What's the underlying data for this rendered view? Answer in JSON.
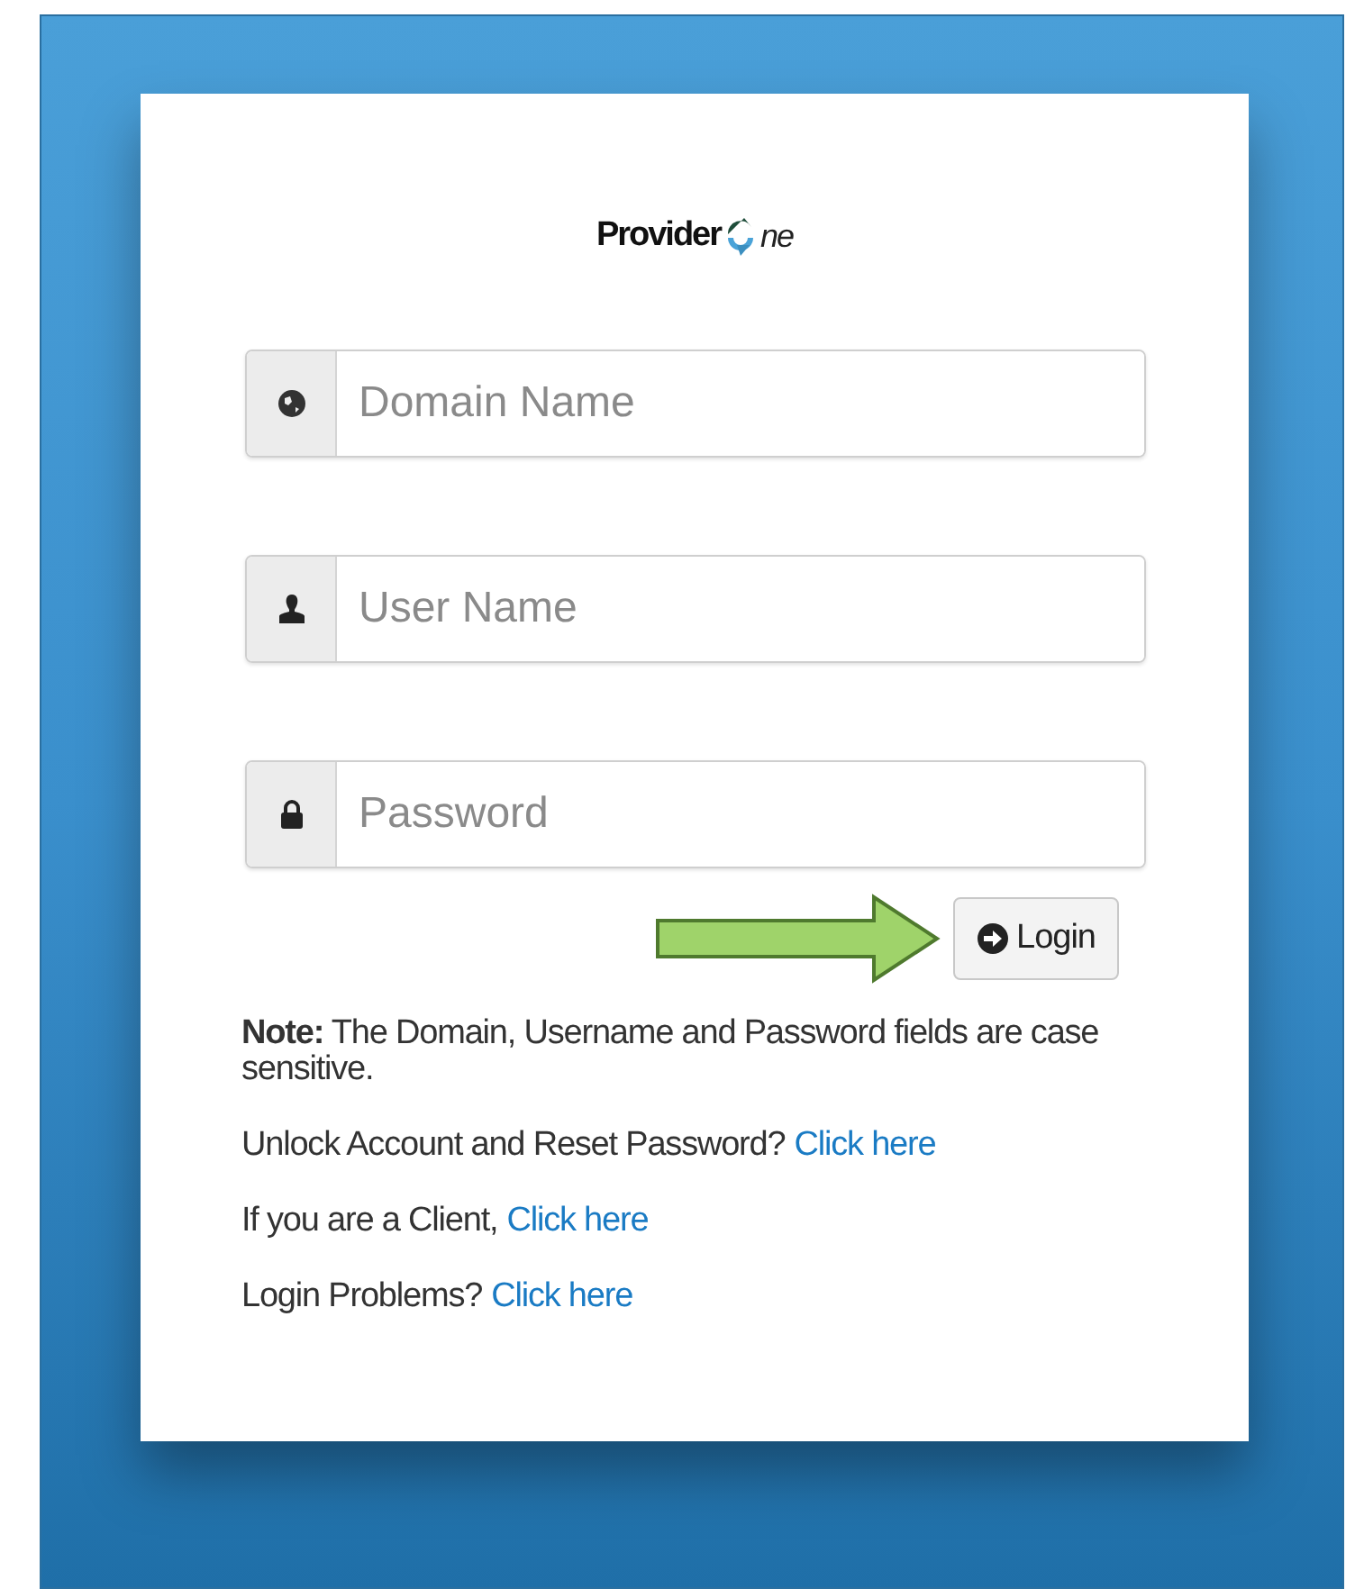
{
  "logo": {
    "prefix": "Provider",
    "suffix": "ne"
  },
  "fields": [
    {
      "kind": "globe",
      "placeholder": "Domain Name"
    },
    {
      "kind": "user",
      "placeholder": "User Name"
    },
    {
      "kind": "lock",
      "placeholder": "Password"
    }
  ],
  "login_button": {
    "label": "Login"
  },
  "note": "**Note:** The Domain, Username and Password fields are case sensitive.",
  "help_lines": [
    {
      "text": "Unlock Account and Reset Password?",
      "link": "Click here"
    },
    {
      "text": "If you are a Client,",
      "link": "Click here"
    },
    {
      "text": "Login Problems?",
      "link": "Click here"
    }
  ]
}
